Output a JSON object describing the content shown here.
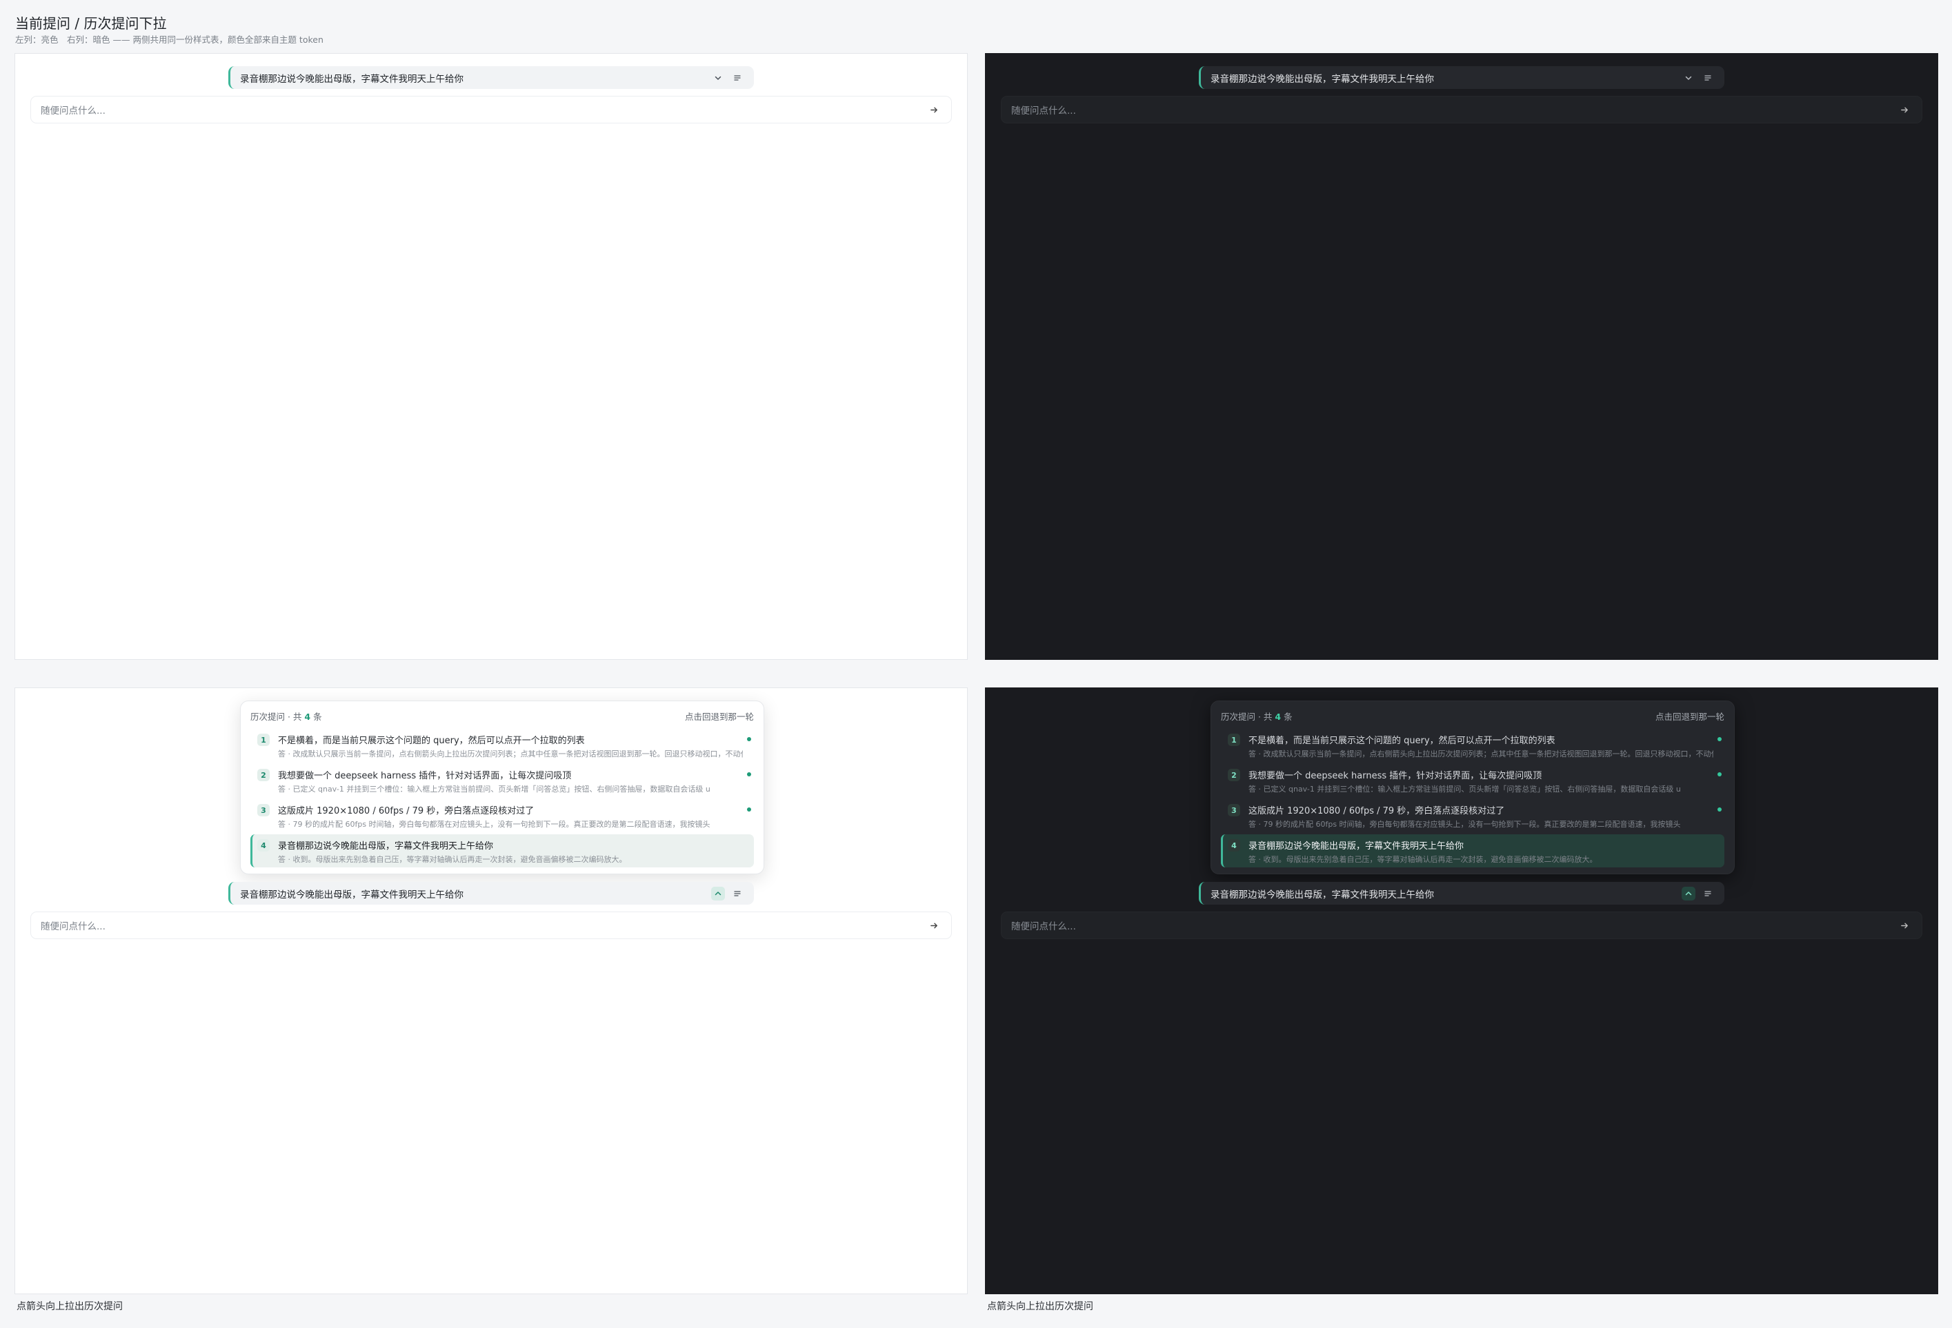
{
  "page": {
    "title": "当前提问 / 历次提问下拉",
    "subtitle": "左列：亮色　右列：暗色 —— 两侧共用同一份样式表，颜色全部来自主题 token"
  },
  "current_query": "录音棚那边说今晚能出母版，字幕文件我明天上午给你",
  "input_placeholder": "随便问点什么...",
  "history": {
    "title": "历次提问 · 共 ",
    "count": "4",
    "unit": " 条",
    "hint": "点击回退到那一轮",
    "items": [
      {
        "num": "1",
        "question": "不是横着，而是当前只展示这个问题的 query，然后可以点开一个拉取的列表",
        "answer": "答 · 改成默认只展示当前一条提问，点右侧箭头向上拉出历次提问列表；点其中任意一条把对话视图回退到那一轮。回退只移动视口，不动代"
      },
      {
        "num": "2",
        "question": "我想要做一个 deepseek harness 插件，针对对话界面，让每次提问吸顶",
        "answer": "答 · 已定义 qnav-1 并挂到三个槽位：输入框上方常驻当前提问、页头新增「问答总览」按钮、右侧问答抽屉，数据取自会话级 u"
      },
      {
        "num": "3",
        "question": "这版成片 1920×1080 / 60fps / 79 秒，旁白落点逐段核对过了",
        "answer": "答 · 79 秒的成片配 60fps 时间轴，旁白每句都落在对应镜头上，没有一句抢到下一段。真正要改的是第二段配音语速，我按镜头"
      },
      {
        "num": "4",
        "question": "录音棚那边说今晚能出母版，字幕文件我明天上午给你",
        "answer": "答 · 收到。母版出来先别急着自己压，等字幕对轴确认后再走一次封装，避免音画偏移被二次编码放大。"
      }
    ]
  },
  "captions": {
    "bottom_left": "点箭头向上拉出历次提问",
    "bottom_right": "点箭头向上拉出历次提问"
  },
  "colors": {
    "accent": "#3fb89a",
    "light_bg": "#ffffff",
    "dark_bg": "#1a1b1f",
    "page_bg": "#f5f6f8"
  },
  "icons": [
    "chevron-down-icon",
    "chevron-up-icon",
    "list-icon",
    "send-arrow-icon"
  ]
}
